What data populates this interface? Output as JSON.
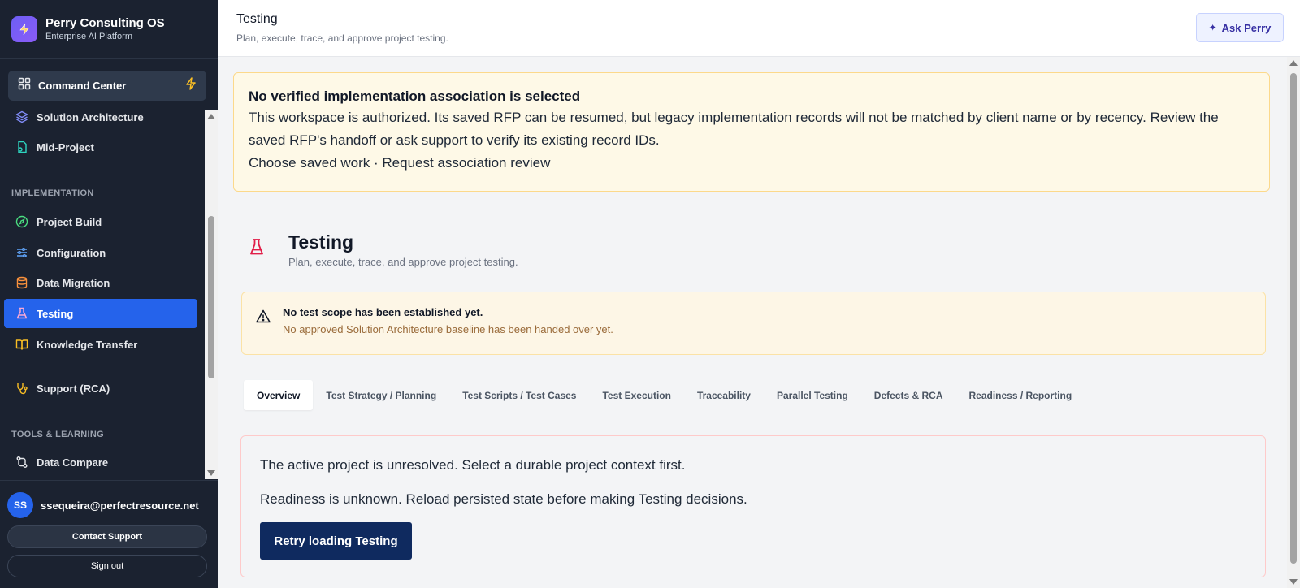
{
  "app": {
    "title": "Perry Consulting OS",
    "subtitle": "Enterprise AI Platform"
  },
  "command_center": {
    "label": "Command Center"
  },
  "sidebar": {
    "items": [
      {
        "label": "Solution Architecture",
        "icon": "layers-icon"
      },
      {
        "label": "Mid-Project",
        "icon": "document-loop-icon"
      },
      {
        "label": "IMPLEMENTATION",
        "type": "section"
      },
      {
        "label": "Project Build",
        "icon": "compass-icon"
      },
      {
        "label": "Configuration",
        "icon": "sliders-icon"
      },
      {
        "label": "Data Migration",
        "icon": "database-icon"
      },
      {
        "label": "Testing",
        "icon": "flask-icon",
        "active": true
      },
      {
        "label": "Knowledge Transfer",
        "icon": "book-icon"
      },
      {
        "label": "Support (RCA)",
        "icon": "stethoscope-icon"
      },
      {
        "label": "TOOLS & LEARNING",
        "type": "section"
      },
      {
        "label": "Data Compare",
        "icon": "git-compare-icon"
      }
    ]
  },
  "user": {
    "initials": "SS",
    "email": "ssequeira@perfectresource.net"
  },
  "footer": {
    "contact_support": "Contact Support",
    "sign_out": "Sign out"
  },
  "header": {
    "title": "Testing",
    "subtitle": "Plan, execute, trace, and approve project testing.",
    "ask_button": "Ask Perry"
  },
  "banner": {
    "title": "No verified implementation association is selected",
    "body": "This workspace is authorized. Its saved RFP can be resumed, but legacy implementation records will not be matched by client name or by recency. Review the saved RFP's handoff or ask support to verify its existing record IDs.",
    "links": "Choose saved work · Request association review"
  },
  "page": {
    "title": "Testing",
    "subtitle": "Plan, execute, trace, and approve project testing."
  },
  "notice": {
    "title": "No test scope has been established yet.",
    "subtitle": "No approved Solution Architecture baseline has been handed over yet."
  },
  "tabs": [
    {
      "label": "Overview",
      "active": true
    },
    {
      "label": "Test Strategy / Planning"
    },
    {
      "label": "Test Scripts / Test Cases"
    },
    {
      "label": "Test Execution"
    },
    {
      "label": "Traceability"
    },
    {
      "label": "Parallel Testing"
    },
    {
      "label": "Defects & RCA"
    },
    {
      "label": "Readiness / Reporting"
    }
  ],
  "error": {
    "line1": "The active project is unresolved. Select a durable project context first.",
    "line2": "Readiness is unknown. Reload persisted state before making Testing decisions.",
    "retry_label": "Retry loading Testing"
  },
  "colors": {
    "sidebar_bg": "#1b2230",
    "active_nav": "#2563eb",
    "retry_button": "#0f2a5f",
    "banner_bg": "#fef9e7"
  }
}
